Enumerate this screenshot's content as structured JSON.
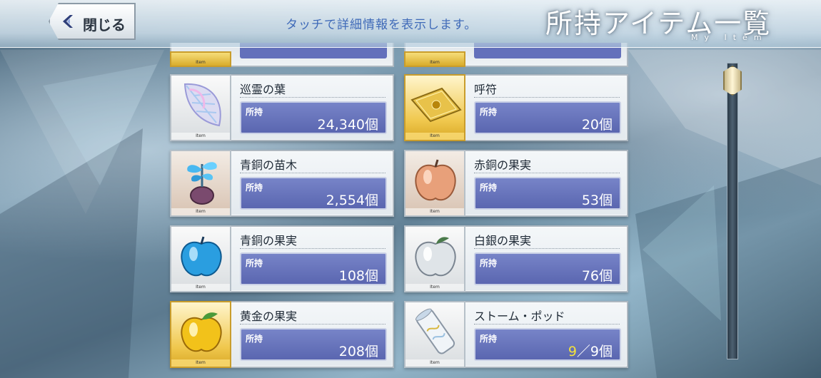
{
  "header": {
    "close_label": "閉じる",
    "hint": "タッチで詳細情報を表示します。",
    "title": "所持アイテム一覧",
    "subtitle": "My Item"
  },
  "item_tag": "Item",
  "own_label": "所持",
  "items": [
    {
      "name": "巡霊の葉",
      "count": "24,340個",
      "icon": "leaf-icon",
      "frame": "silver"
    },
    {
      "name": "呼符",
      "count": "20個",
      "icon": "summon-ticket-icon",
      "frame": "gold"
    },
    {
      "name": "青銅の苗木",
      "count": "2,554個",
      "icon": "bronze-sapling-icon",
      "frame": "bronze"
    },
    {
      "name": "赤銅の果実",
      "count": "53個",
      "icon": "copper-apple-icon",
      "frame": "bronze"
    },
    {
      "name": "青銅の果実",
      "count": "108個",
      "icon": "bronze-apple-icon",
      "frame": "silver"
    },
    {
      "name": "白銀の果実",
      "count": "76個",
      "icon": "silver-apple-icon",
      "frame": "silver"
    },
    {
      "name": "黄金の果実",
      "count": "208個",
      "icon": "golden-apple-icon",
      "frame": "gold"
    },
    {
      "name": "ストーム・ポッド",
      "count_current": "9",
      "count_rest": "／9個",
      "icon": "storm-pod-icon",
      "frame": "silver"
    }
  ],
  "colors": {
    "count_bar": "#5a66b0",
    "highlight": "#f4e23a",
    "hint_text": "#3f6ab8"
  }
}
